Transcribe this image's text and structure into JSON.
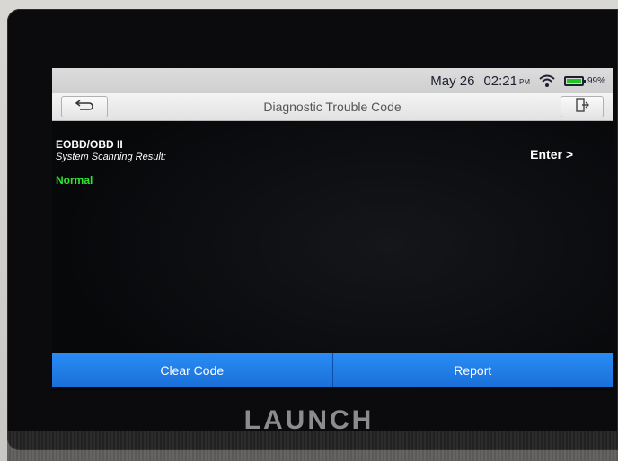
{
  "status_bar": {
    "date": "May 26",
    "time": "02:21",
    "ampm": "PM",
    "battery_percent": "99%",
    "battery_level": 0.99,
    "battery_color": "#21c421"
  },
  "header": {
    "title": "Diagnostic Trouble Code",
    "back_icon": "back-arrow-icon",
    "exit_icon": "exit-icon"
  },
  "systems": [
    {
      "name": "EOBD/OBD II",
      "result_label": "System Scanning Result:",
      "status": "Normal",
      "status_color": "#2ee62e",
      "action_label": "Enter >"
    }
  ],
  "footer": {
    "clear_code_label": "Clear Code",
    "report_label": "Report",
    "accent_color": "#1f7de8"
  },
  "device": {
    "brand": "LAUNCH"
  }
}
